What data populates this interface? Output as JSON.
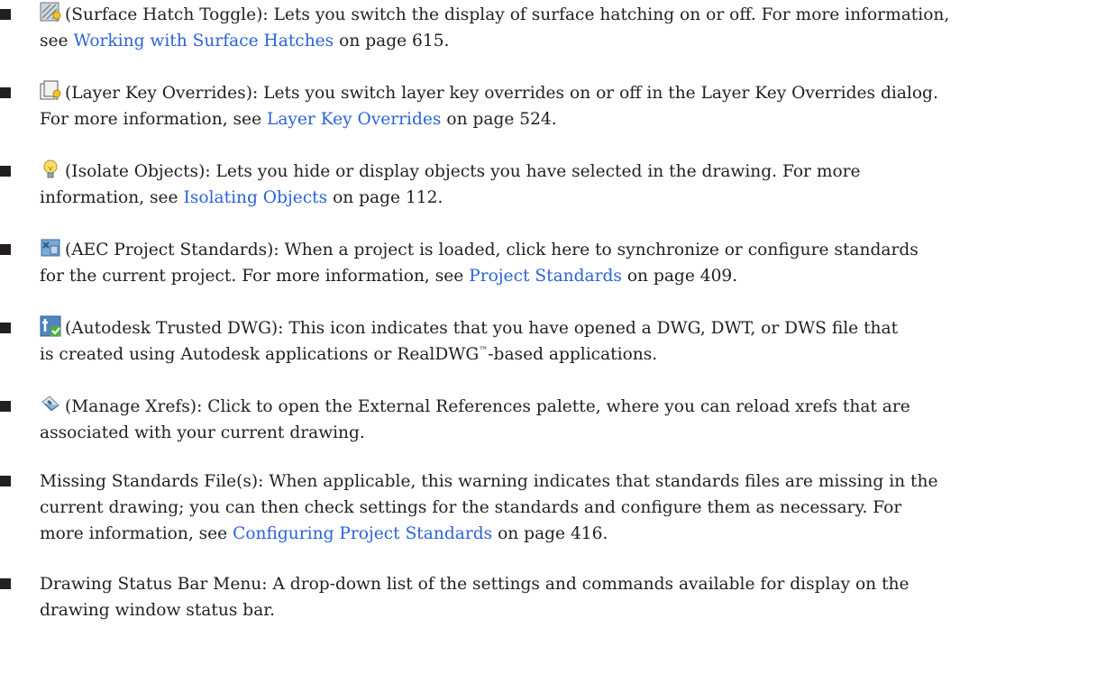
{
  "items": [
    {
      "icon": "surface-hatch-toggle-icon",
      "label": "(Surface Hatch Toggle)",
      "line1": ": Lets you switch the display of surface hatching on or off. For more information,",
      "pre": "see ",
      "link": "Working with Surface Hatches",
      "post": " on page 615."
    },
    {
      "icon": "layer-key-overrides-icon",
      "label": "(Layer Key Overrides)",
      "line1": ": Lets you switch layer key overrides on or off in the Layer Key Overrides dialog.",
      "pre": "For more information, see ",
      "link": "Layer Key Overrides",
      "post": " on page 524."
    },
    {
      "icon": "isolate-objects-icon",
      "label": "(Isolate Objects)",
      "line1": ": Lets you hide or display objects you have selected in the drawing. For more",
      "pre": "information, see ",
      "link": "Isolating Objects",
      "post": " on page 112."
    },
    {
      "icon": "aec-project-standards-icon",
      "label": "(AEC Project Standards)",
      "line1": ": When a project is loaded, click here to synchronize or configure standards",
      "pre": "for the current project. For more information, see ",
      "link": "Project Standards",
      "post": " on page 409."
    },
    {
      "icon": "autodesk-trusted-dwg-icon",
      "label": "(Autodesk Trusted DWG)",
      "line1": ": This icon indicates that you have opened a DWG, DWT, or DWS file that",
      "line2a": "is created using Autodesk applications or RealDWG",
      "tm": "™",
      "line2b": "-based applications."
    },
    {
      "icon": "manage-xrefs-icon",
      "label": "(Manage Xrefs)",
      "line1": ": Click to open the External References palette, where you can reload xrefs that are",
      "line2": "associated with your current drawing."
    },
    {
      "label": "Missing Standards File(s)",
      "line1": ": When applicable, this warning indicates that standards files are missing in the",
      "line2": "current drawing; you can then check settings for the standards and configure them as necessary. For",
      "pre": "more information, see ",
      "link": "Configuring Project Standards",
      "post": " on page 416."
    },
    {
      "label": "Drawing Status Bar Menu",
      "line1": ": A drop-down list of the settings and commands available for display on the",
      "line2": "drawing window status bar."
    }
  ],
  "colors": {
    "link": "#2a63d8",
    "text": "#231f20"
  }
}
